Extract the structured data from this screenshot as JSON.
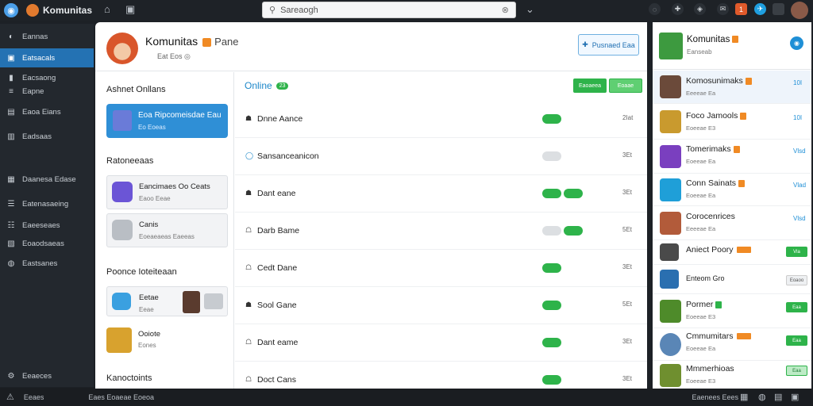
{
  "topbar": {
    "app_title": "Komunitas",
    "search_placeholder": "Sareaogh",
    "notif_count": "1"
  },
  "sidebar": {
    "items": [
      {
        "label": "Eannas",
        "icon": "chat-icon"
      },
      {
        "label": "Eatsacals",
        "icon": "home-icon"
      },
      {
        "label": "Eacsaong",
        "icon": "book-icon"
      },
      {
        "label": "Eapne",
        "icon": "list-icon"
      },
      {
        "label": "Eaoa Eians",
        "icon": "grid-icon"
      },
      {
        "label": "Eadsaas",
        "icon": "folder-icon"
      },
      {
        "label": "Daanesa Edase",
        "icon": "calendar-icon"
      },
      {
        "label": "Eatenasaeing",
        "icon": "stack-icon"
      },
      {
        "label": "Eaeeseaes",
        "icon": "people-icon"
      },
      {
        "label": "Eoaodsaeas",
        "icon": "chart-icon"
      },
      {
        "label": "Eastsanes",
        "icon": "globe-icon"
      },
      {
        "label": "Eeaeces",
        "icon": "gear-icon"
      }
    ]
  },
  "bottombar": {
    "left_label": "Eeaes",
    "center_label": "Eaes Eoaeae Eoeoa",
    "right_label": "Eaenees Eees"
  },
  "header": {
    "name": "Komunitas",
    "role": "Pane",
    "subtitle": "Eat Eos",
    "button_label": "Pusnaed Eaa"
  },
  "left_column": {
    "section1_title": "Ashnet Onllans",
    "featured": {
      "title": "Eoa Ripcomeisdae Eau",
      "subtitle": "Eo Eoeas"
    },
    "section2_title": "Ratoneeaas",
    "cards": [
      {
        "title": "Eancimaes Oo Ceats",
        "subtitle": "Eaoo Eeae"
      },
      {
        "title": "Canis",
        "subtitle": "Eoeaeaeas Eaeeas"
      }
    ],
    "section3_title": "Poonce Ioteiteaan",
    "people": [
      {
        "title": "Eetae",
        "subtitle": "Eeae"
      },
      {
        "title": "Ooiote",
        "subtitle": "Eones"
      }
    ],
    "section4_title": "Kanoctoints"
  },
  "middle": {
    "title": "Online",
    "count": "23",
    "button1": "Eaoaeea",
    "button2": "Eoaae",
    "rows": [
      {
        "name": "Dnne Aance",
        "value": "2Iat",
        "pills": [
          "green"
        ]
      },
      {
        "name": "Sansanceanicon",
        "value": "3Et",
        "pills": [
          "gray"
        ]
      },
      {
        "name": "Dant eane",
        "value": "3Et",
        "pills": [
          "green",
          "green"
        ]
      },
      {
        "name": "Darb Bame",
        "value": "5Et",
        "pills": [
          "gray",
          "green"
        ]
      },
      {
        "name": "Cedt Dane",
        "value": "3Et",
        "pills": [
          "green"
        ]
      },
      {
        "name": "Sool Gane",
        "value": "5Et",
        "pills": [
          "green"
        ]
      },
      {
        "name": "Dant eame",
        "value": "3Et",
        "pills": [
          "green"
        ]
      },
      {
        "name": "Doct Cans",
        "value": "3Et",
        "pills": [
          "green"
        ]
      }
    ]
  },
  "right_panel": {
    "title": "Komunitas",
    "subtitle": "Eanseab",
    "rows": [
      {
        "title": "Komosunimaks",
        "subtitle": "Eeeeae Ea",
        "value": "10I",
        "color": "#6b4a3a",
        "selected": true
      },
      {
        "title": "Foco Jamools",
        "subtitle": "Eoeeae E3",
        "value": "10I",
        "color": "#c99a2e"
      },
      {
        "title": "Tomerimaks",
        "subtitle": "Eoeeae Ea",
        "value": "Vlsd",
        "color": "#7a3fbf"
      },
      {
        "title": "Conn Sainats",
        "subtitle": "Eoeeae Ea",
        "value": "Vlad",
        "color": "#1f9fd8"
      },
      {
        "title": "Corocenrices",
        "subtitle": "Eeeeae Ea",
        "value": "Vlsd",
        "color": "#b25b3a"
      },
      {
        "title": "Aniect Poory",
        "subtitle": "",
        "value": "Vla",
        "color": "#4a4a4a",
        "pill": "green"
      },
      {
        "title": "Enteom Gro",
        "subtitle": "",
        "value": "Eoaoo",
        "color": "#2a6fb0",
        "pill": "gray"
      },
      {
        "title": "Pormer",
        "subtitle": "Eoeeae E3",
        "value": "Eaa",
        "color": "#4e8b2a",
        "pill": "green"
      },
      {
        "title": "Cmmumitars",
        "subtitle": "Eoeeae Ea",
        "value": "Eaa",
        "color": "#5a86b6",
        "pill": "green"
      },
      {
        "title": "Mmmerhioas",
        "subtitle": "Eoeeae E3",
        "value": "Eaa",
        "color": "#6f8f2f",
        "pill": "lightgreen"
      }
    ]
  },
  "colors": {
    "accent": "#2472b3",
    "online_green": "#2eb34a",
    "badge_orange": "#f08a24"
  }
}
